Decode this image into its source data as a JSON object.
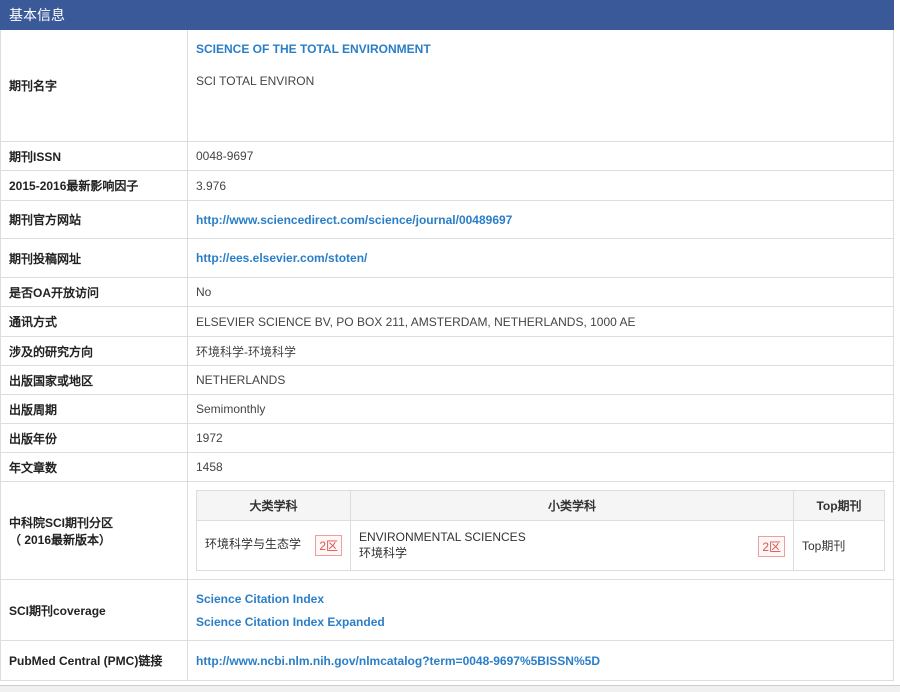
{
  "section_title": "基本信息",
  "rows": {
    "name": {
      "label": "期刊名字",
      "full": "SCIENCE OF THE TOTAL ENVIRONMENT",
      "abbr": "SCI TOTAL ENVIRON"
    },
    "issn": {
      "label": "期刊ISSN",
      "value": "0048-9697"
    },
    "impact": {
      "label": "2015-2016最新影响因子",
      "value": "3.976"
    },
    "website": {
      "label": "期刊官方网站",
      "value": "http://www.sciencedirect.com/science/journal/00489697"
    },
    "submit": {
      "label": "期刊投稿网址",
      "value": "http://ees.elsevier.com/stoten/"
    },
    "oa": {
      "label": "是否OA开放访问",
      "value": "No"
    },
    "contact": {
      "label": "通讯方式",
      "value": "ELSEVIER SCIENCE BV, PO BOX 211, AMSTERDAM, NETHERLANDS, 1000 AE"
    },
    "field": {
      "label": "涉及的研究方向",
      "value": "环境科学-环境科学"
    },
    "country": {
      "label": "出版国家或地区",
      "value": "NETHERLANDS"
    },
    "cycle": {
      "label": "出版周期",
      "value": "Semimonthly"
    },
    "year": {
      "label": "出版年份",
      "value": "1972"
    },
    "articles": {
      "label": "年文章数",
      "value": "1458"
    },
    "cas": {
      "label": "中科院SCI期刊分区",
      "label2": "（ 2016最新版本）",
      "headers": {
        "major": "大类学科",
        "minor": "小类学科",
        "top": "Top期刊"
      },
      "major_value": "环境科学与生态学",
      "major_zone": "2区",
      "minor_en": "ENVIRONMENTAL SCIENCES",
      "minor_cn": "环境科学",
      "minor_zone": "2区",
      "top_value": "Top期刊"
    },
    "coverage": {
      "label": "SCI期刊coverage",
      "items": [
        "Science Citation Index",
        "Science Citation Index Expanded"
      ]
    },
    "pmc": {
      "label": "PubMed Central (PMC)链接",
      "value": "http://www.ncbi.nlm.nih.gov/nlmcatalog?term=0048-9697%5BISSN%5D"
    }
  }
}
